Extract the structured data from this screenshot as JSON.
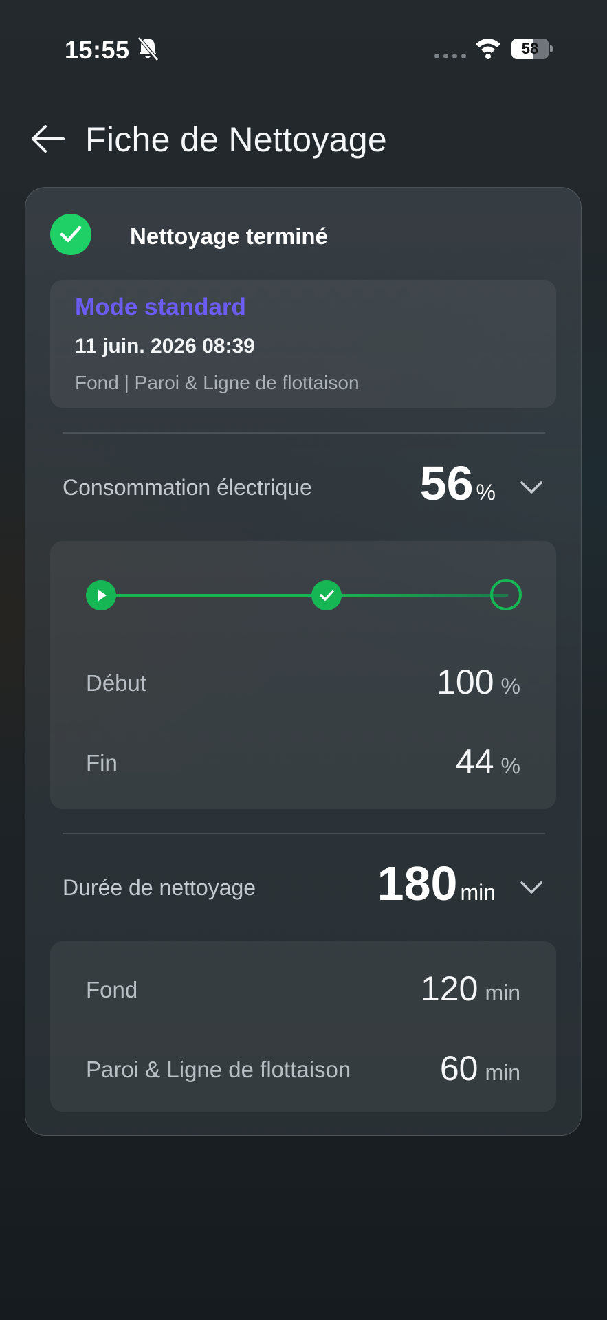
{
  "status_bar": {
    "time": "15:55",
    "battery": "58",
    "battery_level": 0.58,
    "icons": [
      "bell-off-icon",
      "signal-dots-icon",
      "wifi-icon",
      "battery-icon"
    ]
  },
  "header": {
    "title": "Fiche de Nettoyage",
    "back_icon": "arrow-left-icon"
  },
  "status": {
    "label": "Nettoyage terminé",
    "icon": "check-circle-icon",
    "color": "#1fd066"
  },
  "mode": {
    "name": "Mode standard",
    "name_color": "#6b5cf2",
    "datetime": "11 juin. 2026 08:39",
    "zones": "Fond | Paroi & Ligne de flottaison"
  },
  "power": {
    "label": "Consommation électrique",
    "value": "56",
    "unit": "%",
    "progress_steps": [
      "start",
      "done",
      "pending"
    ],
    "start": {
      "label": "Début",
      "value": "100",
      "unit": "%"
    },
    "end": {
      "label": "Fin",
      "value": "44",
      "unit": "%"
    }
  },
  "duration": {
    "label": "Durée de nettoyage",
    "value": "180",
    "unit": "min",
    "items": [
      {
        "label": "Fond",
        "value": "120",
        "unit": "min"
      },
      {
        "label": "Paroi & Ligne de flottaison",
        "value": "60",
        "unit": "min"
      }
    ]
  },
  "colors": {
    "accent_green": "#17b655",
    "mode_purple": "#6b5cf2"
  }
}
